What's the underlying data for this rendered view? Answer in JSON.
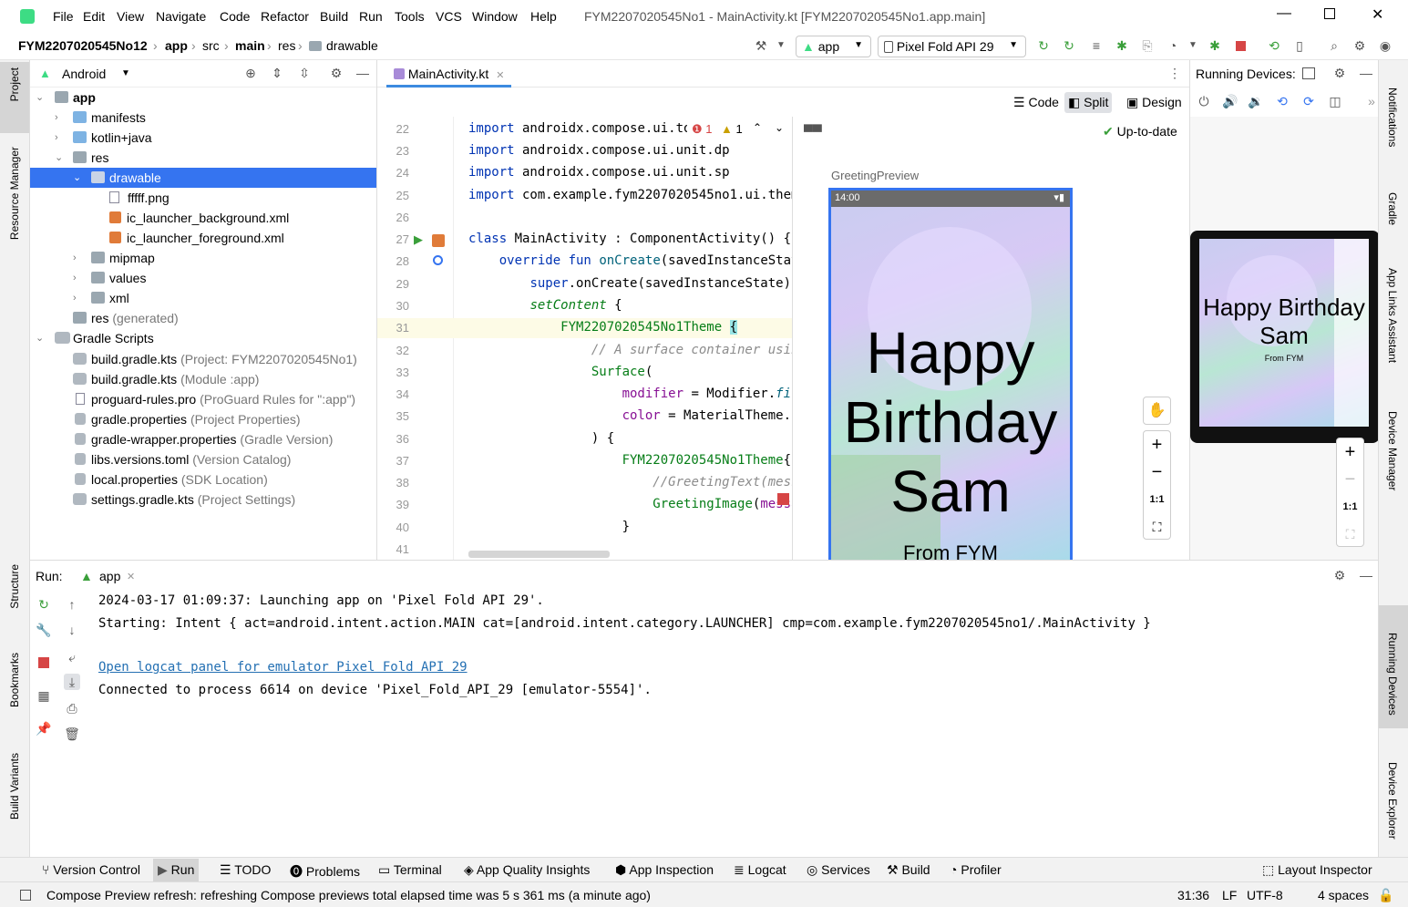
{
  "menu": [
    "File",
    "Edit",
    "View",
    "Navigate",
    "Code",
    "Refactor",
    "Build",
    "Run",
    "Tools",
    "VCS",
    "Window",
    "Help"
  ],
  "window_title": "FYM2207020545No1 - MainActivity.kt [FYM2207020545No1.app.main]",
  "breadcrumb": [
    "FYM2207020545No12",
    "app",
    "src",
    "main",
    "res",
    "drawable"
  ],
  "toolbar": {
    "run_config": "app",
    "device": "Pixel Fold API 29"
  },
  "project": {
    "view_mode": "Android",
    "tree": [
      {
        "label": "app",
        "note": "",
        "icon": "module"
      },
      {
        "label": "manifests",
        "note": "",
        "icon": "folder"
      },
      {
        "label": "kotlin+java",
        "note": "",
        "icon": "folder"
      },
      {
        "label": "res",
        "note": "",
        "icon": "folder-res"
      },
      {
        "label": "drawable",
        "note": "",
        "icon": "folder"
      },
      {
        "label": "fffff.png",
        "note": "",
        "icon": "image"
      },
      {
        "label": "ic_launcher_background.xml",
        "note": "",
        "icon": "xml"
      },
      {
        "label": "ic_launcher_foreground.xml",
        "note": "",
        "icon": "xml"
      },
      {
        "label": "mipmap",
        "note": "",
        "icon": "folder"
      },
      {
        "label": "values",
        "note": "",
        "icon": "folder"
      },
      {
        "label": "xml",
        "note": "",
        "icon": "folder"
      },
      {
        "label": "res",
        "note": "(generated)",
        "icon": "folder-res"
      },
      {
        "label": "Gradle Scripts",
        "note": "",
        "icon": "gradle"
      },
      {
        "label": "build.gradle.kts",
        "note": "(Project: FYM2207020545No1)",
        "icon": "gradle-file"
      },
      {
        "label": "build.gradle.kts",
        "note": "(Module :app)",
        "icon": "gradle-file"
      },
      {
        "label": "proguard-rules.pro",
        "note": "(ProGuard Rules for \":app\")",
        "icon": "file"
      },
      {
        "label": "gradle.properties",
        "note": "(Project Properties)",
        "icon": "props"
      },
      {
        "label": "gradle-wrapper.properties",
        "note": "(Gradle Version)",
        "icon": "props"
      },
      {
        "label": "libs.versions.toml",
        "note": "(Version Catalog)",
        "icon": "props"
      },
      {
        "label": "local.properties",
        "note": "(SDK Location)",
        "icon": "props"
      },
      {
        "label": "settings.gradle.kts",
        "note": "(Project Settings)",
        "icon": "gradle-file"
      }
    ]
  },
  "editor": {
    "tab": "MainActivity.kt",
    "errors": "1",
    "warnings": "1",
    "line_numbers": [
      "22",
      "23",
      "24",
      "25",
      "26",
      "27",
      "28",
      "29",
      "30",
      "31",
      "32",
      "33",
      "34",
      "35",
      "36",
      "37",
      "38",
      "39",
      "40",
      "41"
    ]
  },
  "view_modes": {
    "code": "Code",
    "split": "Split",
    "design": "Design"
  },
  "preview": {
    "status": "Up-to-date",
    "label": "GreetingPreview",
    "time": "14:00",
    "line1": "Happy",
    "line2": "Birthday",
    "line3": "Sam",
    "from": "From FYM",
    "zoom_fit": "1:1"
  },
  "running_devices": {
    "title": "Running Devices:",
    "text1": "Happy Birthday",
    "text2": "Sam",
    "from": "From FYM",
    "zoom_fit": "1:1"
  },
  "side_tabs_left": [
    "Project",
    "Resource Manager",
    "Structure",
    "Bookmarks",
    "Build Variants"
  ],
  "side_tabs_right": [
    "Notifications",
    "Gradle",
    "App Links Assistant",
    "Device Manager",
    "Running Devices",
    "Device Explorer"
  ],
  "run": {
    "label": "Run:",
    "tab": "app",
    "log": [
      "2024-03-17 01:09:37: Launching app on 'Pixel Fold API 29'.",
      "Starting: Intent { act=android.intent.action.MAIN cat=[android.intent.category.LAUNCHER] cmp=com.example.fym2207020545no1/.MainActivity }",
      "Open logcat panel for emulator Pixel Fold API 29",
      "Connected to process 6614 on device 'Pixel_Fold_API_29 [emulator-5554]'."
    ]
  },
  "bottom_tabs": [
    "Version Control",
    "Run",
    "TODO",
    "Problems",
    "Terminal",
    "App Quality Insights",
    "App Inspection",
    "Logcat",
    "Services",
    "Build",
    "Profiler",
    "Layout Inspector"
  ],
  "status": {
    "message": "Compose Preview refresh: refreshing Compose previews total elapsed time was 5 s 361 ms (a minute ago)",
    "position": "31:36",
    "line_sep": "LF",
    "encoding": "UTF-8",
    "indent": "4 spaces"
  }
}
